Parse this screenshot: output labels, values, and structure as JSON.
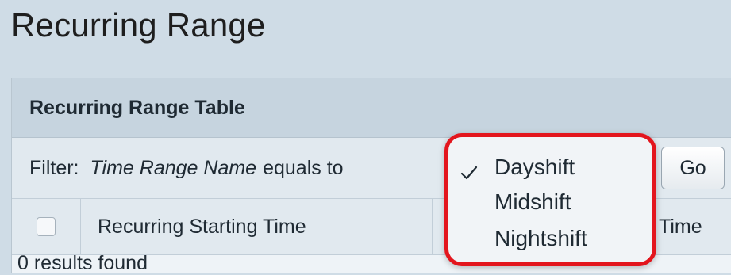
{
  "page": {
    "title": "Recurring Range"
  },
  "panel": {
    "title": "Recurring Range Table"
  },
  "filter": {
    "label": "Filter:",
    "field": "Time Range Name",
    "operator": "equals to",
    "options": [
      "Dayshift",
      "Midshift",
      "Nightshift"
    ],
    "selected": "Dayshift",
    "go_label": "Go"
  },
  "table": {
    "columns": [
      "Recurring Starting Time",
      "Time"
    ],
    "status": "0 results found"
  },
  "colors": {
    "highlight": "#e3151d",
    "header_bg": "#c6d4df"
  },
  "icons": {
    "selected_option": "check-icon"
  }
}
